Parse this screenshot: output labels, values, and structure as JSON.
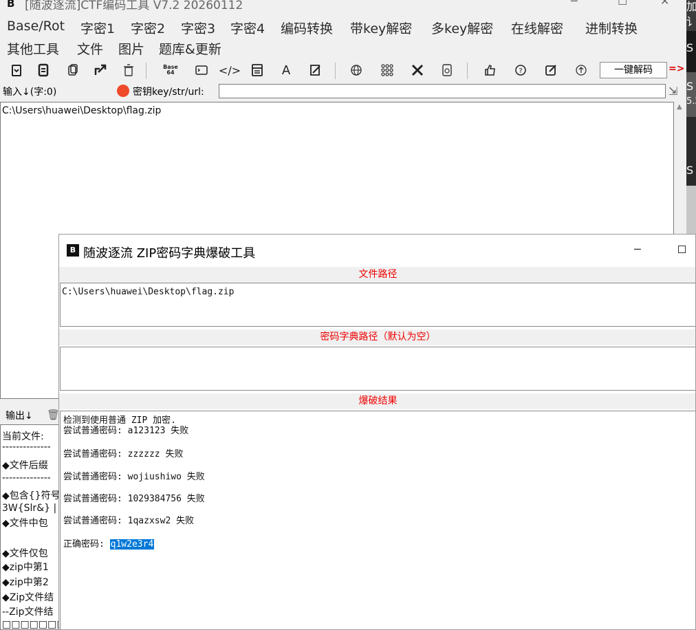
{
  "app": {
    "icon": "B",
    "title": "[随波逐流]CTF编码工具 V7.2  20260112",
    "window_controls": [
      "─",
      "☐",
      "✕"
    ]
  },
  "menu": {
    "items": [
      "Base/Rot",
      "字密1",
      "字密2",
      "字密3",
      "字密4",
      "编码转换",
      "带key解密",
      "多key解密",
      "在线解密",
      "进制转换",
      "其他工具",
      "文件",
      "图片",
      "题库&更新"
    ]
  },
  "toolbar": {
    "one_click_label": "一键解码",
    "arrow": "=>",
    "icons": [
      "paste-icon",
      "copy-icon",
      "duplicate-icon",
      "share-icon",
      "trash-icon",
      "base64-icon",
      "terminal-icon",
      "code-icon",
      "calculator-icon",
      "font-icon",
      "edit-doc-icon",
      "globe-icon",
      "grid-icon",
      "tools-icon",
      "document-icon",
      "thumbs-up-icon",
      "help-icon",
      "edit-icon",
      "upload-icon"
    ]
  },
  "input": {
    "label": "输入↓(字:0)",
    "key_label": "密钥key/str/url:",
    "key_value": "",
    "content": "C:\\Users\\huawei\\Desktop\\flag.zip"
  },
  "output": {
    "label": "输出↓",
    "lines": [
      "当前文件:",
      "--------------",
      "◆文件后缀",
      "--------------",
      "◆包含{}符号",
      "3W{Slr&} |",
      "◆文件中包",
      "",
      "◆文件仅包",
      "◆zip中第1",
      "◆zip中第2",
      "◆Zip文件结",
      "--Zip文件结",
      "□□□□□□□□"
    ]
  },
  "right_edge": {
    "chars": [
      "加",
      "讠",
      "S",
      "S",
      "5.2",
      "S"
    ]
  },
  "dialog": {
    "icon": "B",
    "title": "随波逐流 ZIP密码字典爆破工具",
    "min_label": "─",
    "file_path_header": "文件路径",
    "file_path_value": "C:\\Users\\huawei\\Desktop\\flag.zip",
    "dict_header": "密码字典路径（默认为空）",
    "dict_value": "",
    "result_header": "爆破结果",
    "result_lines": [
      "检测到使用普通 ZIP 加密.",
      "尝试普通密码: a123123 失败",
      "尝试普通密码: zzzzzz 失败",
      "尝试普通密码: wojiushiwo 失败",
      "尝试普通密码: 1029384756 失败",
      "尝试普通密码: 1qazxsw2 失败"
    ],
    "correct_label": "正确密码: ",
    "correct_password": "q1w2e3r4"
  },
  "colors": {
    "section_header_text": "#e00000",
    "selection": "#0078d7",
    "key_icon": "#ef4a2a"
  }
}
